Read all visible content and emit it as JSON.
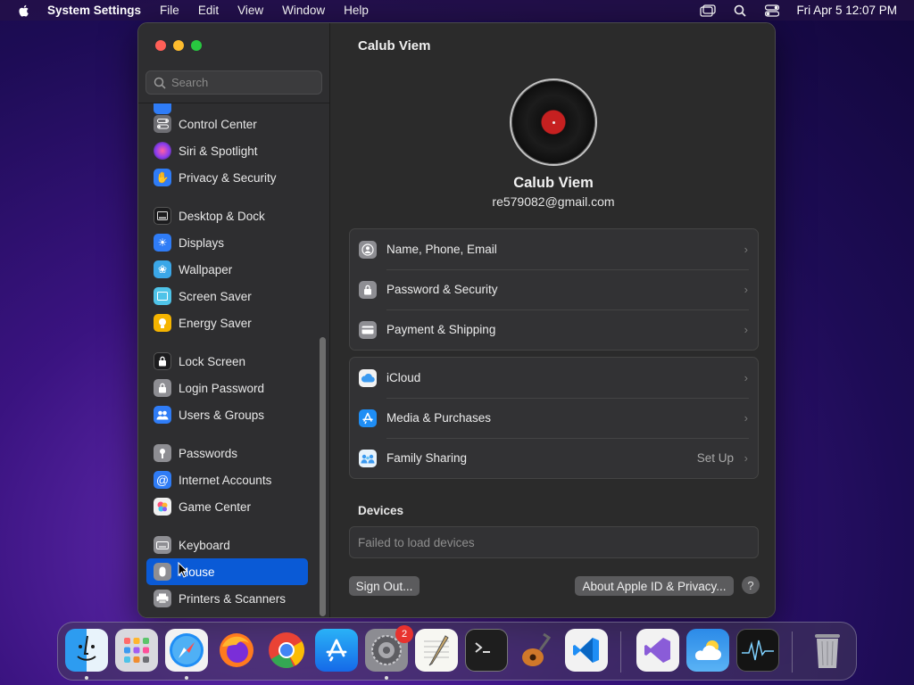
{
  "menubar": {
    "app_name": "System Settings",
    "menus": [
      "File",
      "Edit",
      "View",
      "Window",
      "Help"
    ],
    "clock": "Fri Apr 5  12:07 PM"
  },
  "sidebar": {
    "search_placeholder": "Search",
    "items": [
      {
        "label": "Control Center",
        "icon": "control-center-icon",
        "color": "#6e6e73"
      },
      {
        "label": "Siri & Spotlight",
        "icon": "siri-icon",
        "color": "#b14fd8"
      },
      {
        "label": "Privacy & Security",
        "icon": "hand-icon",
        "color": "#2f7cf6"
      },
      {
        "label": "Desktop & Dock",
        "icon": "desktop-dock-icon",
        "color": "#1c1c1e"
      },
      {
        "label": "Displays",
        "icon": "sun-icon",
        "color": "#2f7cf6"
      },
      {
        "label": "Wallpaper",
        "icon": "flower-icon",
        "color": "#3ba7e8"
      },
      {
        "label": "Screen Saver",
        "icon": "screen-saver-icon",
        "color": "#4fc3e8"
      },
      {
        "label": "Energy Saver",
        "icon": "bulb-icon",
        "color": "#f5b400"
      },
      {
        "label": "Lock Screen",
        "icon": "lock-icon",
        "color": "#1c1c1e"
      },
      {
        "label": "Login Password",
        "icon": "lock-icon",
        "color": "#8e8e93"
      },
      {
        "label": "Users & Groups",
        "icon": "users-icon",
        "color": "#2f7cf6"
      },
      {
        "label": "Passwords",
        "icon": "key-icon",
        "color": "#8e8e93"
      },
      {
        "label": "Internet Accounts",
        "icon": "at-icon",
        "color": "#2f7cf6"
      },
      {
        "label": "Game Center",
        "icon": "game-center-icon",
        "color": "#f0f0f0"
      },
      {
        "label": "Keyboard",
        "icon": "keyboard-icon",
        "color": "#8e8e93"
      },
      {
        "label": "Mouse",
        "icon": "mouse-icon",
        "color": "#8e8e93"
      },
      {
        "label": "Printers & Scanners",
        "icon": "printer-icon",
        "color": "#8e8e93"
      }
    ]
  },
  "main": {
    "title": "Calub Viem",
    "user_name": "Calub Viem",
    "user_email": "re579082@gmail.com",
    "group1": [
      {
        "label": "Name, Phone, Email",
        "icon": "contact-icon"
      },
      {
        "label": "Password & Security",
        "icon": "lock-icon"
      },
      {
        "label": "Payment & Shipping",
        "icon": "card-icon"
      }
    ],
    "group2": [
      {
        "label": "iCloud",
        "icon": "icloud-icon"
      },
      {
        "label": "Media & Purchases",
        "icon": "app-store-icon"
      },
      {
        "label": "Family Sharing",
        "icon": "family-icon",
        "detail": "Set Up"
      }
    ],
    "devices_title": "Devices",
    "devices_message": "Failed to load devices",
    "sign_out_label": "Sign Out...",
    "about_label": "About Apple ID & Privacy...",
    "help_label": "?"
  },
  "dock": {
    "apps": [
      "Finder",
      "Launchpad",
      "Safari",
      "Firefox",
      "Chrome",
      "App Store",
      "System Settings",
      "TextEdit",
      "Terminal",
      "GarageBand",
      "VS Code",
      "Visual Studio",
      "Weather",
      "Activity Monitor",
      "Trash"
    ],
    "settings_badge": "2"
  }
}
